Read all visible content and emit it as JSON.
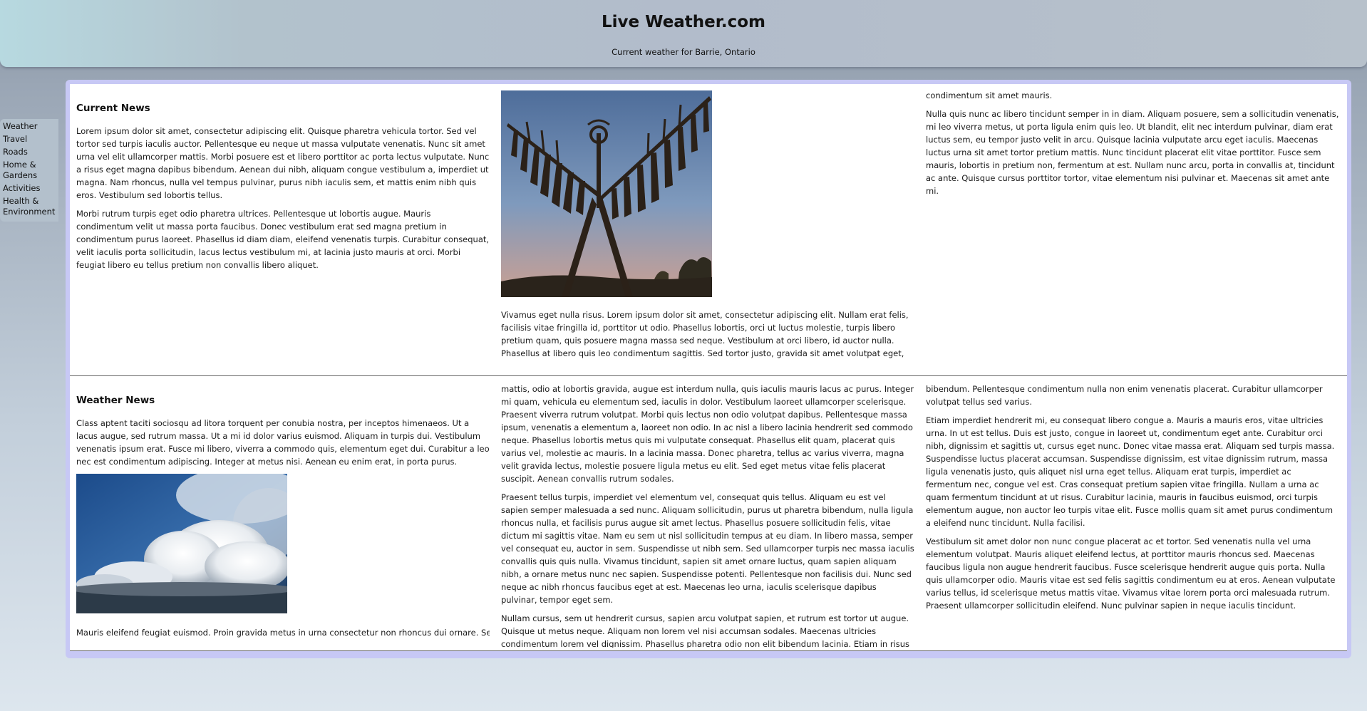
{
  "header": {
    "title": "Live Weather.com",
    "subtitle": "Current weather for Barrie, Ontario"
  },
  "sidebar": {
    "items": [
      {
        "label": "Weather"
      },
      {
        "label": "Travel"
      },
      {
        "label": "Roads"
      },
      {
        "label": "Home & Gardens"
      },
      {
        "label": "Activities"
      },
      {
        "label": "Health & Environment"
      }
    ]
  },
  "colors": {
    "frame": "#c7c8f5",
    "panel": "#ffffff",
    "sidebar": "#b3c0cc"
  },
  "current_news": {
    "heading": "Current News",
    "col1": [
      "Lorem ipsum dolor sit amet, consectetur adipiscing elit. Quisque pharetra vehicula tortor. Sed vel tortor sed turpis iaculis auctor. Pellentesque eu neque ut massa vulputate venenatis. Nunc sit amet urna vel elit ullamcorper mattis. Morbi posuere est et libero porttitor ac porta lectus vulputate. Nunc a risus eget magna dapibus bibendum. Aenean dui nibh, aliquam congue vestibulum a, imperdiet ut magna. Nam rhoncus, nulla vel tempus pulvinar, purus nibh iaculis sem, et mattis enim nibh quis eros. Vestibulum sed lobortis tellus.",
      "Morbi rutrum turpis eget odio pharetra ultrices. Pellentesque ut lobortis augue. Mauris condimentum velit ut massa porta faucibus. Donec vestibulum erat sed magna pretium in condimentum purus laoreet. Phasellus id diam diam, eleifend venenatis turpis. Curabitur consequat, velit iaculis porta sollicitudin, lacus lectus vestibulum mi, at lacinia justo mauris at orci. Morbi feugiat libero eu tellus pretium non convallis libero aliquet."
    ],
    "image_icon": "sculpture-image",
    "col2": [
      "Vivamus eget nulla risus. Lorem ipsum dolor sit amet, consectetur adipiscing elit. Nullam erat felis, facilisis vitae fringilla id, porttitor ut odio. Phasellus lobortis, orci ut luctus molestie, turpis libero pretium quam, quis posuere magna massa sed neque. Vestibulum at orci libero, id auctor nulla. Phasellus at libero quis leo condimentum sagittis. Sed tortor justo, gravida sit amet volutpat eget,"
    ],
    "col3": [
      "condimentum sit amet mauris.",
      "Nulla quis nunc ac libero tincidunt semper in in diam. Aliquam posuere, sem a sollicitudin venenatis, mi leo viverra metus, ut porta ligula enim quis leo. Ut blandit, elit nec interdum pulvinar, diam erat luctus sem, eu tempor justo velit in arcu. Quisque lacinia vulputate arcu eget iaculis. Maecenas luctus urna sit amet tortor pretium mattis. Nunc tincidunt placerat elit vitae porttitor. Fusce sem mauris, lobortis in pretium non, fermentum at est. Nullam nunc arcu, porta in convallis at, tincidunt ac ante. Quisque cursus porttitor tortor, vitae elementum nisi pulvinar et. Maecenas sit amet ante mi."
    ]
  },
  "weather_news": {
    "heading": "Weather News",
    "col1": [
      "Class aptent taciti sociosqu ad litora torquent per conubia nostra, per inceptos himenaeos. Ut a lacus augue, sed rutrum massa. Ut a mi id dolor varius euismod. Aliquam in turpis dui. Vestibulum venenatis ipsum erat. Fusce mi libero, viverra a commodo quis, elementum eget dui. Curabitur a leo nec est condimentum adipiscing. Integer at metus nisi. Aenean eu enim erat, in porta purus."
    ],
    "image_icon": "clouds-image",
    "col1_after": "Mauris eleifend feugiat euismod. Proin gravida metus in urna consectetur non rhoncus dui ornare. Sed",
    "col2": [
      "mattis, odio at lobortis gravida, augue est interdum nulla, quis iaculis mauris lacus ac purus. Integer mi quam, vehicula eu elementum sed, iaculis in dolor. Vestibulum laoreet ullamcorper scelerisque. Praesent viverra rutrum volutpat. Morbi quis lectus non odio volutpat dapibus. Pellentesque massa ipsum, venenatis a elementum a, laoreet non odio. In ac nisl a libero lacinia hendrerit sed commodo neque. Phasellus lobortis metus quis mi vulputate consequat. Phasellus elit quam, placerat quis varius vel, molestie ac mauris. In a lacinia massa. Donec pharetra, tellus ac varius viverra, magna velit gravida lectus, molestie posuere ligula metus eu elit. Sed eget metus vitae felis placerat suscipit. Aenean convallis rutrum sodales.",
      "Praesent tellus turpis, imperdiet vel elementum vel, consequat quis tellus. Aliquam eu est vel sapien semper malesuada a sed nunc. Aliquam sollicitudin, purus ut pharetra bibendum, nulla ligula rhoncus nulla, et facilisis purus augue sit amet lectus. Phasellus posuere sollicitudin felis, vitae dictum mi sagittis vitae. Nam eu sem ut nisl sollicitudin tempus at eu diam. In libero massa, semper vel consequat eu, auctor in sem. Suspendisse ut nibh sem. Sed ullamcorper turpis nec massa iaculis convallis quis quis nulla. Vivamus tincidunt, sapien sit amet ornare luctus, quam sapien aliquam nibh, a ornare metus nunc nec sapien. Suspendisse potenti. Pellentesque non facilisis dui. Nunc sed neque ac nibh rhoncus faucibus eget at est. Maecenas leo urna, iaculis scelerisque dapibus pulvinar, tempor eget sem.",
      "Nullam cursus, sem ut hendrerit cursus, sapien arcu volutpat sapien, et rutrum est tortor ut augue. Quisque ut metus neque. Aliquam non lorem vel nisi accumsan sodales. Maecenas ultricies condimentum lorem vel dignissim. Phasellus pharetra odio non elit bibendum lacinia. Etiam in risus ac tortor mollis"
    ],
    "col3": [
      "bibendum. Pellentesque condimentum nulla non enim venenatis placerat. Curabitur ullamcorper volutpat tellus sed varius.",
      "Etiam imperdiet hendrerit mi, eu consequat libero congue a. Mauris a mauris eros, vitae ultricies urna. In ut est tellus. Duis est justo, congue in laoreet ut, condimentum eget ante. Curabitur orci nibh, dignissim et sagittis ut, cursus eget nunc. Donec vitae massa erat. Aliquam sed turpis massa. Suspendisse luctus placerat accumsan. Suspendisse dignissim, est vitae dignissim rutrum, massa ligula venenatis justo, quis aliquet nisl urna eget tellus. Aliquam erat turpis, imperdiet ac fermentum nec, congue vel est. Cras consequat pretium sapien vitae fringilla. Nullam a urna ac quam fermentum tincidunt at ut risus. Curabitur lacinia, mauris in faucibus euismod, orci turpis elementum augue, non auctor leo turpis vitae elit. Fusce mollis quam sit amet purus condimentum a eleifend nunc tincidunt. Nulla facilisi.",
      "Vestibulum sit amet dolor non nunc congue placerat ac et tortor. Sed venenatis nulla vel urna elementum volutpat. Mauris aliquet eleifend lectus, at porttitor mauris rhoncus sed. Maecenas faucibus ligula non augue hendrerit faucibus. Fusce scelerisque hendrerit augue quis porta. Nulla quis ullamcorper odio. Mauris vitae est sed felis sagittis condimentum eu at eros. Aenean vulputate varius tellus, id scelerisque metus mattis vitae. Vivamus vitae lorem porta orci malesuada rutrum. Praesent ullamcorper sollicitudin eleifend. Nunc pulvinar sapien in neque iaculis tincidunt."
    ]
  }
}
